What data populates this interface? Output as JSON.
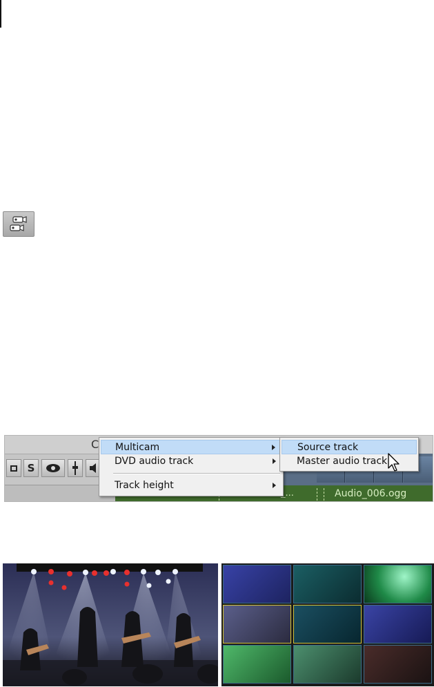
{
  "timeline": {
    "header_fragment": "C",
    "track_buttons": [
      "S"
    ],
    "audio_clip_label": "Audio_006.ogg",
    "audio_clip_label2": "_..."
  },
  "context_menu": {
    "items": [
      {
        "label": "Multicam",
        "has_submenu": true,
        "highlighted": true
      },
      {
        "label": "DVD audio track",
        "has_submenu": true,
        "highlighted": false
      },
      {
        "label": "Track height",
        "has_submenu": true,
        "highlighted": false
      }
    ]
  },
  "submenu": {
    "items": [
      {
        "label": "Source track",
        "highlighted": true
      },
      {
        "label": "Master audio track",
        "highlighted": false
      }
    ]
  },
  "icons": {
    "toolbar": "multicam-icon",
    "cursor": "mouse-pointer-icon"
  },
  "colors": {
    "menu_highlight": "#c1dcf7",
    "audio_track": "#3f6b2c",
    "video_track": "#5a6e86",
    "selected_cam_border": "#d4c43a"
  },
  "camera_grid": {
    "rows": 3,
    "cols": 3,
    "selected_cells": [
      "r1c0",
      "r1c1"
    ]
  }
}
